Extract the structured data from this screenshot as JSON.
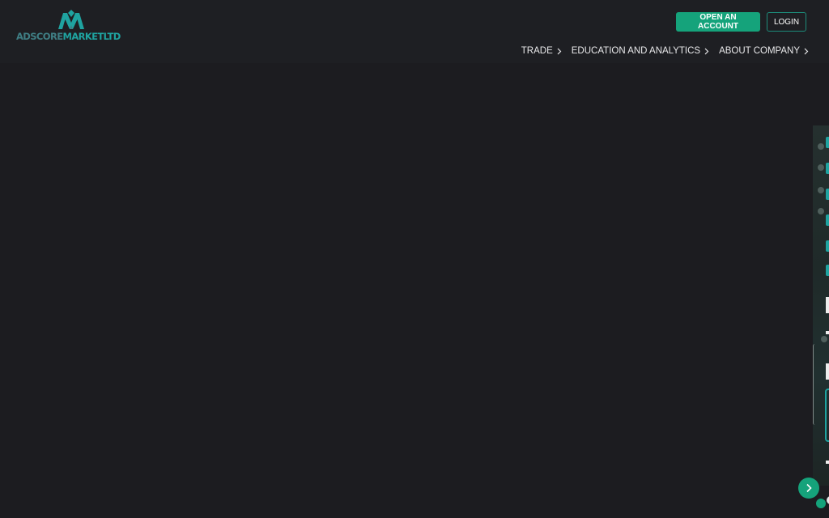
{
  "header": {
    "logo": {
      "part1": "ADSCORE",
      "part2": "MARKETLTD"
    },
    "open_account_label": "OPEN AN ACCOUNT",
    "login_label": "LOGIN",
    "nav": [
      {
        "label": "TRADE"
      },
      {
        "label": "EDUCATION AND ANALYTICS"
      },
      {
        "label": "ABOUT COMPANY"
      }
    ]
  },
  "slider": {
    "next_icon": "chevron-right-icon"
  },
  "colors": {
    "background": "#1c1c20",
    "accent": "#15a37b",
    "logo_teal": "#1fa3a0"
  }
}
